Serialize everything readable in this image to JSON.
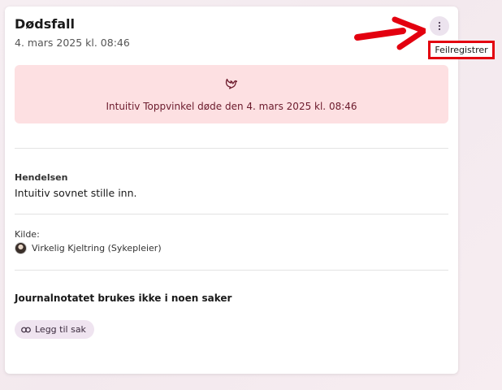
{
  "card": {
    "title": "Dødsfall",
    "date": "4. mars 2025 kl. 08:46",
    "banner": {
      "icon": "dove-icon",
      "text": "Intuitiv Toppvinkel døde den 4. mars 2025 kl. 08:46"
    },
    "event": {
      "label": "Hendelsen",
      "value": "Intuitiv sovnet stille inn."
    },
    "source": {
      "label": "Kilde:",
      "name": "Virkelig Kjeltring (Sykepleier)"
    },
    "journal": {
      "text": "Journalnotatet brukes ikke i noen saker",
      "add_button_label": "Legg til sak"
    }
  },
  "menu": {
    "icon": "more-vertical-icon",
    "items": [
      "Feilregistrer"
    ]
  },
  "colors": {
    "banner_bg": "#fde0e2",
    "banner_text": "#6b1a2c",
    "accent_chip": "#efe4f0",
    "annotation_red": "#e3000f"
  }
}
